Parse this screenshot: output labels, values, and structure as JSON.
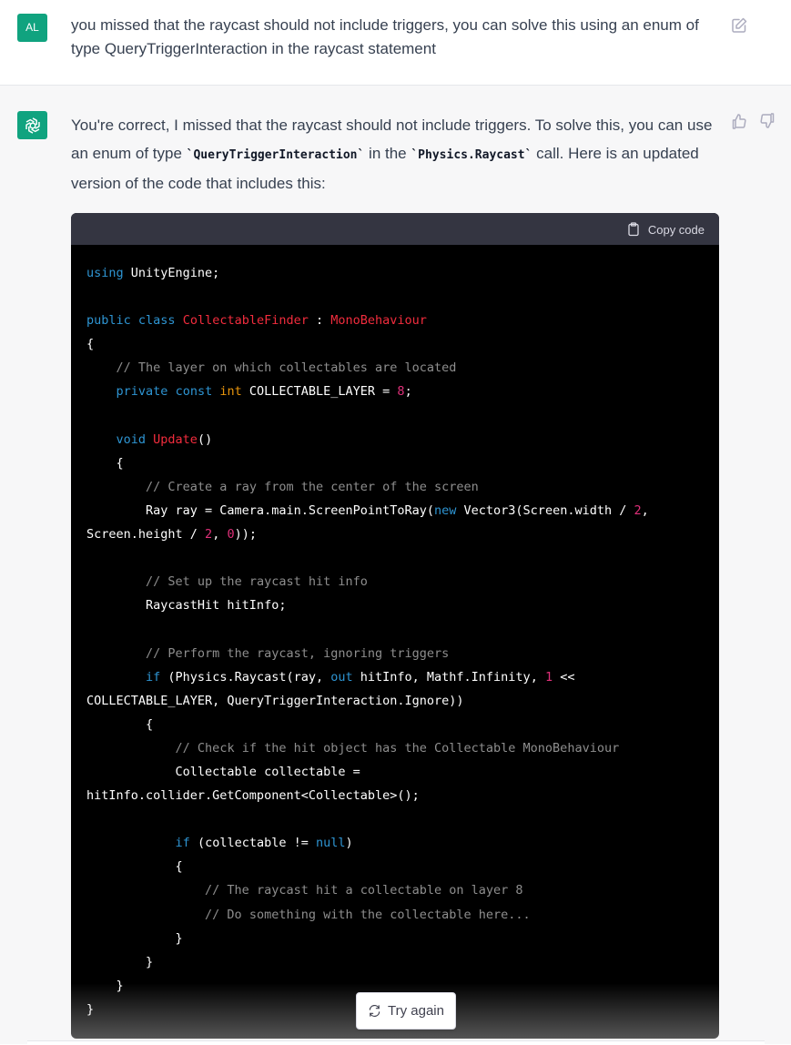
{
  "user_message": {
    "avatar_initials": "AL",
    "text": "you missed that the raycast should not include triggers, you can solve this using an enum of type QueryTriggerInteraction in the raycast statement",
    "edit_icon": "edit-icon"
  },
  "assistant_message": {
    "intro_1": "You're correct, I missed that the raycast should not include triggers. To solve this, you can use an enum of type ",
    "code_ref_1": "`QueryTriggerInteraction`",
    "intro_2": " in the ",
    "code_ref_2": "`Physics.Raycast`",
    "intro_3": " call. Here is an updated version of the code that includes this:",
    "thumbs_up_icon": "thumbs-up-icon",
    "thumbs_down_icon": "thumbs-down-icon"
  },
  "code_block": {
    "copy_label": "Copy code",
    "lines": [
      [
        [
          "kw",
          "using"
        ],
        [
          "t",
          " UnityEngine;"
        ]
      ],
      [],
      [
        [
          "kw",
          "public"
        ],
        [
          "t",
          " "
        ],
        [
          "kw",
          "class"
        ],
        [
          "t",
          " "
        ],
        [
          "ty",
          "CollectableFinder"
        ],
        [
          "t",
          " : "
        ],
        [
          "ty",
          "MonoBehaviour"
        ]
      ],
      [
        [
          "t",
          "{"
        ]
      ],
      [
        [
          "t",
          "    "
        ],
        [
          "cm",
          "// The layer on which collectables are located"
        ]
      ],
      [
        [
          "t",
          "    "
        ],
        [
          "kw",
          "private"
        ],
        [
          "t",
          " "
        ],
        [
          "kw",
          "const"
        ],
        [
          "t",
          " "
        ],
        [
          "yl",
          "int"
        ],
        [
          "t",
          " COLLECTABLE_LAYER = "
        ],
        [
          "num",
          "8"
        ],
        [
          "t",
          ";"
        ]
      ],
      [],
      [
        [
          "t",
          "    "
        ],
        [
          "kw",
          "void"
        ],
        [
          "t",
          " "
        ],
        [
          "ty",
          "Update"
        ],
        [
          "t",
          "()"
        ]
      ],
      [
        [
          "t",
          "    {"
        ]
      ],
      [
        [
          "t",
          "        "
        ],
        [
          "cm",
          "// Create a ray from the center of the screen"
        ]
      ],
      [
        [
          "t",
          "        Ray ray = Camera.main.ScreenPointToRay("
        ],
        [
          "kw",
          "new"
        ],
        [
          "t",
          " Vector3(Screen.width / "
        ],
        [
          "num",
          "2"
        ],
        [
          "t",
          ","
        ]
      ],
      [
        [
          "t",
          "Screen.height / "
        ],
        [
          "num",
          "2"
        ],
        [
          "t",
          ", "
        ],
        [
          "num",
          "0"
        ],
        [
          "t",
          "));"
        ]
      ],
      [],
      [
        [
          "t",
          "        "
        ],
        [
          "cm",
          "// Set up the raycast hit info"
        ]
      ],
      [
        [
          "t",
          "        RaycastHit hitInfo;"
        ]
      ],
      [],
      [
        [
          "t",
          "        "
        ],
        [
          "cm",
          "// Perform the raycast, ignoring triggers"
        ]
      ],
      [
        [
          "t",
          "        "
        ],
        [
          "kw",
          "if"
        ],
        [
          "t",
          " (Physics.Raycast(ray, "
        ],
        [
          "kw",
          "out"
        ],
        [
          "t",
          " hitInfo, Mathf.Infinity, "
        ],
        [
          "num",
          "1"
        ],
        [
          "t",
          " <<"
        ]
      ],
      [
        [
          "t",
          "COLLECTABLE_LAYER, QueryTriggerInteraction.Ignore))"
        ]
      ],
      [
        [
          "t",
          "        {"
        ]
      ],
      [
        [
          "t",
          "            "
        ],
        [
          "cm",
          "// Check if the hit object has the Collectable MonoBehaviour"
        ]
      ],
      [
        [
          "t",
          "            Collectable collectable ="
        ]
      ],
      [
        [
          "t",
          "hitInfo.collider.GetComponent<Collectable>();"
        ]
      ],
      [],
      [
        [
          "t",
          "            "
        ],
        [
          "kw",
          "if"
        ],
        [
          "t",
          " (collectable != "
        ],
        [
          "kw",
          "null"
        ],
        [
          "t",
          ")"
        ]
      ],
      [
        [
          "t",
          "            {"
        ]
      ],
      [
        [
          "t",
          "                "
        ],
        [
          "cm",
          "// The raycast hit a collectable on layer 8"
        ]
      ],
      [
        [
          "t",
          "                "
        ],
        [
          "cm",
          "// Do something with the collectable here..."
        ]
      ],
      [
        [
          "t",
          "            }"
        ]
      ],
      [
        [
          "t",
          "        }"
        ]
      ],
      [
        [
          "t",
          "    }"
        ]
      ],
      [
        [
          "t",
          "}"
        ]
      ]
    ]
  },
  "try_again": {
    "label": "Try again",
    "icon": "refresh-icon"
  }
}
